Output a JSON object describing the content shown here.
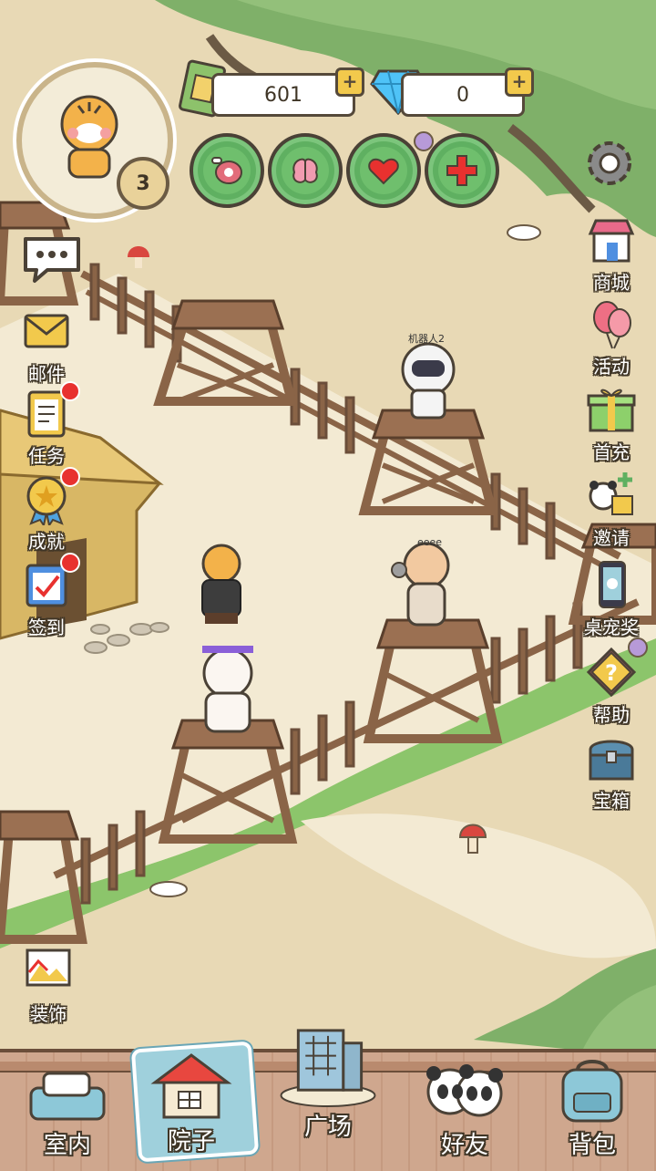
{
  "hud": {
    "level": "3",
    "cash": "601",
    "gems": "0"
  },
  "stats": [
    {
      "icon": "meat-icon"
    },
    {
      "icon": "brain-icon"
    },
    {
      "icon": "heart-icon"
    },
    {
      "icon": "health-cross-icon"
    }
  ],
  "left_menu": {
    "mail": "邮件",
    "tasks": "任务",
    "achievements": "成就",
    "checkin": "签到",
    "decorate": "装饰"
  },
  "right_menu": {
    "shop": "商城",
    "events": "活动",
    "first_recharge": "首充",
    "invite": "邀请",
    "desktop_pet": "桌宠奖",
    "help": "帮助",
    "chest": "宝箱"
  },
  "characters": {
    "robot_name": "机器人2",
    "hamster_name": "eeee"
  },
  "bottom_nav": {
    "indoor": "室内",
    "yard": "院子",
    "plaza": "广场",
    "friends": "好友",
    "backpack": "背包"
  },
  "colors": {
    "ground": "#e8d9b5",
    "path": "#f3ead3",
    "grass": "#8cc56b",
    "tree": "#7fb069",
    "wood": "#8a6447",
    "notification": "#e8312f",
    "stat_button": "#5fb061"
  }
}
